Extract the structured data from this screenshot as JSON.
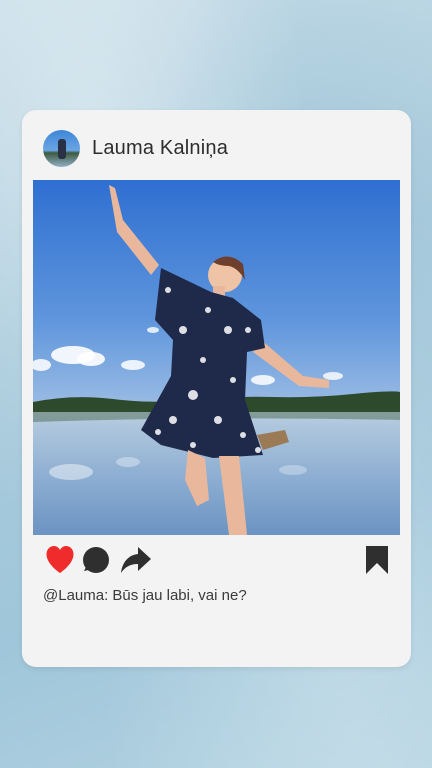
{
  "post": {
    "username": "Lauma Kalniņa",
    "caption": "@Lauma: Būs jau labi, vai ne?"
  },
  "icons": {
    "like": "heart-icon",
    "comment": "comment-icon",
    "share": "share-icon",
    "save": "bookmark-icon"
  },
  "colors": {
    "like": "#ef2b2b",
    "icon_dark": "#2f2f2f",
    "card": "#f3f3f3"
  }
}
